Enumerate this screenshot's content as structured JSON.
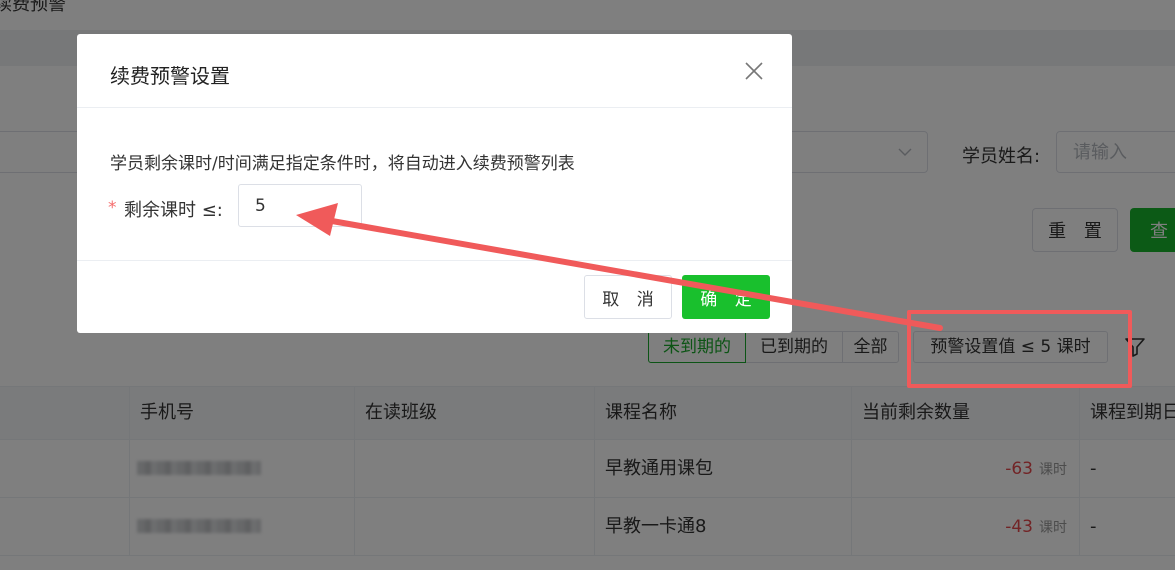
{
  "page": {
    "title": "续费预警"
  },
  "filters": {
    "name_label": "学员姓名:",
    "name_placeholder": "请输入",
    "reset_label": "重 置",
    "query_label": "查"
  },
  "segments": [
    {
      "label": "未到期的",
      "active": true
    },
    {
      "label": "已到期的",
      "active": false
    },
    {
      "label": "全部",
      "active": false
    }
  ],
  "warning_setting_label": "预警设置值 ≤ 5 课时",
  "table": {
    "columns": [
      "手机号",
      "在读班级",
      "课程名称",
      "当前剩余数量",
      "课程到期日"
    ],
    "rows": [
      {
        "phone": "",
        "class": "",
        "course": "早教通用课包",
        "remaining": "-63",
        "unit": "课时",
        "expiry": "-"
      },
      {
        "phone": "",
        "class": "",
        "course": "早教一卡通8",
        "remaining": "-43",
        "unit": "课时",
        "expiry": "-"
      }
    ]
  },
  "dialog": {
    "title": "续费预警设置",
    "description": "学员剩余课时/时间满足指定条件时，将自动进入续费预警列表",
    "required_mark": "*",
    "field_label": "剩余课时 ≤:",
    "field_value": "5",
    "cancel_label": "取 消",
    "ok_label": "确 定"
  },
  "colors": {
    "accent_green": "#19c02d",
    "annotation_red": "#f05a5a",
    "negative_red": "#e5484d"
  },
  "icons": [
    "chevron-down-icon",
    "close-icon",
    "filter-icon",
    "annotation-arrow"
  ]
}
